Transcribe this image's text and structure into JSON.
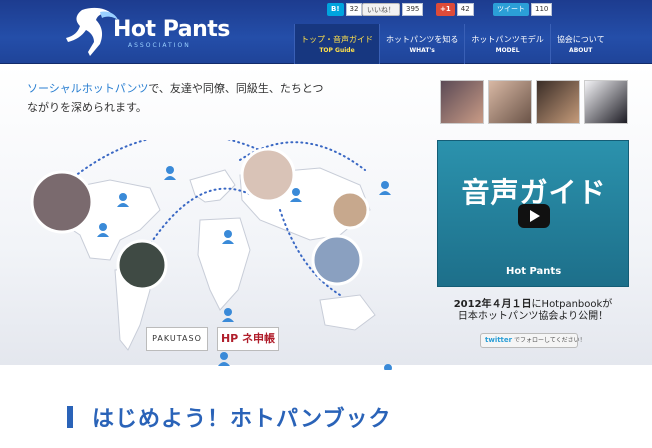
{
  "header": {
    "logo_text": "Hot Pants",
    "logo_sub": "ASSOCIATION"
  },
  "social": {
    "hatena": {
      "label": "B!",
      "count": "32"
    },
    "like": {
      "label": "いいね！",
      "count": "395"
    },
    "gplus": {
      "label": "+1",
      "count": "42"
    },
    "tweet": {
      "label": "ツイート",
      "count": "110"
    }
  },
  "nav": [
    {
      "jp": "トップ・音声ガイド",
      "en": "TOP Guide",
      "active": true
    },
    {
      "jp": "ホットパンツを知る",
      "en": "WHAT's",
      "active": false
    },
    {
      "jp": "ホットパンツモデル",
      "en": "MODEL",
      "active": false
    },
    {
      "jp": "協会について",
      "en": "ABOUT",
      "active": false
    }
  ],
  "hero": {
    "tagline_hl": "ソーシャルホットパンツ",
    "tagline_rest": "で、友達や同僚、同級生、たちとつながりを深められます。",
    "video_title": "音声ガイド",
    "video_logo": "Hot Pants",
    "date_line1_bold": "2012年４月１日",
    "date_line1_rest": "にHotpanbookが",
    "date_line2": "日本ホットパンツ協会より公開！",
    "twitter_label": "twitter",
    "twitter_text": "でフォローしてください！",
    "badge1": "PAKUTASO",
    "badge2": "HP ネ申帳"
  },
  "bottom": {
    "title": "はじめよう！ホトパンブック"
  },
  "colors": {
    "header_blue": "#244ea9",
    "accent_yellow": "#ffe14a",
    "link_blue": "#2a7fd1",
    "video_teal": "#2b92ad"
  }
}
